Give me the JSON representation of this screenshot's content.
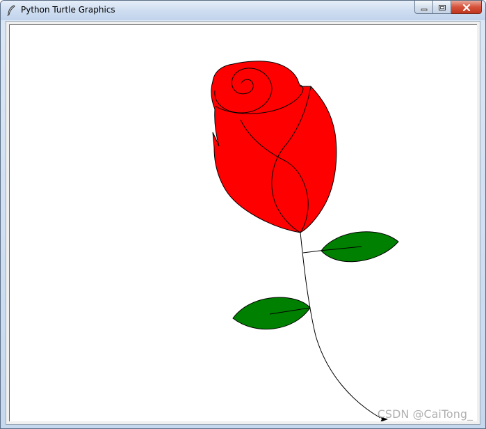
{
  "window": {
    "title": "Python Turtle Graphics",
    "icon": "feather-icon",
    "controls": [
      "minimize-icon",
      "maximize-icon",
      "close-icon"
    ]
  },
  "canvas": {
    "background": "#ffffff",
    "drawing": "rose",
    "colors": {
      "petals": "#ff0000",
      "leaves": "#008000",
      "outline": "#000000"
    }
  },
  "watermark": "CSDN @CaiTong_"
}
